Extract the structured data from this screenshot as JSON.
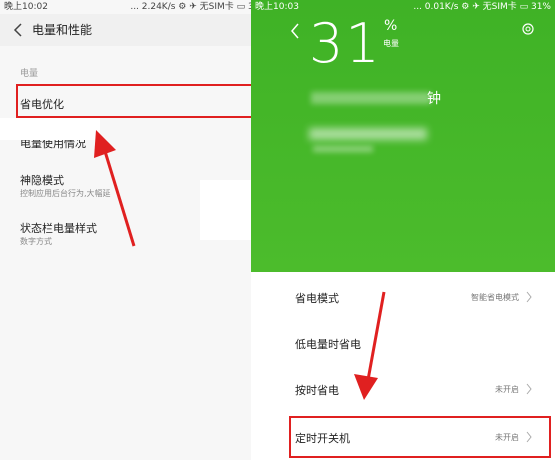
{
  "left_screen": {
    "status_bar": {
      "time": "晚上10:02",
      "info": "... 2.24K/s ⚙ ✈ 无SIM卡 ▭ 31%"
    },
    "header": {
      "title": "电量和性能"
    },
    "section_label": "电量",
    "items": [
      {
        "title": "省电优化"
      },
      {
        "title": "电量使用情况"
      },
      {
        "title": "神隐模式",
        "subtitle": "控制应用后台行为,大幅延"
      },
      {
        "title": "状态栏电量样式",
        "subtitle": "数字方式"
      }
    ]
  },
  "right_screen": {
    "status_bar": {
      "time": "晚上10:03",
      "info": "... 0.01K/s ⚙ ✈ 无SIM卡 ▭ 31%"
    },
    "battery": {
      "level": "31",
      "percent_symbol": "%",
      "label": "电量",
      "remaining_text": "钟"
    },
    "items": [
      {
        "title": "省电模式",
        "value": "智能省电模式"
      },
      {
        "title": "低电量时省电",
        "value": ""
      },
      {
        "title": "按时省电",
        "value": "未开启"
      },
      {
        "title": "定时开关机",
        "value": "未开启"
      }
    ]
  },
  "colors": {
    "accent_green": "#4cbc2c",
    "annotation_red": "#e02020"
  }
}
